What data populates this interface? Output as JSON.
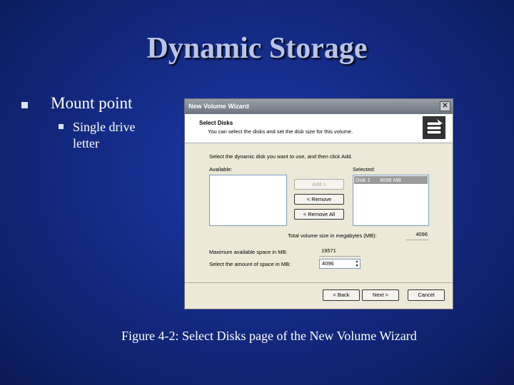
{
  "slide": {
    "title": "Dynamic Storage",
    "bullets": [
      {
        "text": "Mount point",
        "subbullets": [
          {
            "text": "Single drive letter"
          }
        ]
      }
    ],
    "caption": "Figure 4-2: Select Disks page of the New Volume Wizard"
  },
  "dialog": {
    "title": "New Volume Wizard",
    "close_glyph": "✕",
    "header_title": "Select Disks",
    "header_subtitle": "You can select the disks and set the disk size for this volume.",
    "header_icon": "disk-stack-icon",
    "instruction": "Select the dynamic disk you want to use, and then click Add.",
    "available_label": "Available:",
    "selected_label": "Selected:",
    "selected_items": [
      {
        "disk": "Disk 1",
        "size": "4096 MB"
      }
    ],
    "add_button": "Add >",
    "remove_button": "< Remove",
    "remove_all_button": "< Remove All",
    "total_size_label": "Total volume size in megabytes (MB):",
    "total_size_value": "4096",
    "max_space_label": "Maximum available space in MB:",
    "max_space_value": "19571",
    "amount_label": "Select the amount of space in MB:",
    "amount_value": "4096",
    "back_button": "< Back",
    "next_button": "Next >",
    "cancel_button": "Cancel"
  }
}
